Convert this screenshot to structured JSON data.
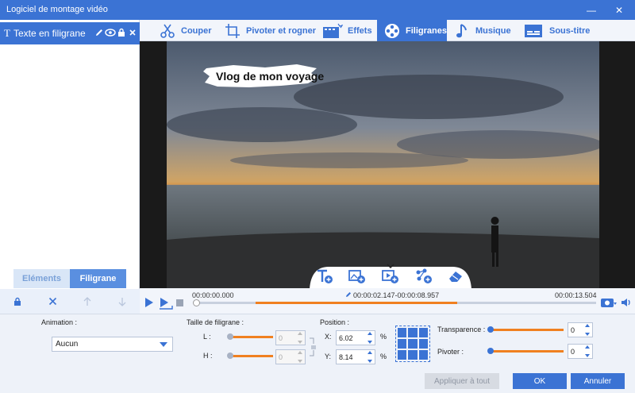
{
  "window": {
    "title": "Logiciel de montage vidéo",
    "minimize": "—",
    "close": "✕"
  },
  "sidebar": {
    "watermark_item": "Texte en filigrane",
    "tabs": {
      "elements": "Eléments",
      "filigrane": "Filigrane"
    }
  },
  "tabs": [
    {
      "label": "Couper",
      "icon": "cut-icon"
    },
    {
      "label": "Pivoter et rogner",
      "icon": "rotate-crop-icon"
    },
    {
      "label": "Effets",
      "icon": "effects-icon"
    },
    {
      "label": "Filigranes",
      "icon": "watermark-icon",
      "active": true
    },
    {
      "label": "Musique",
      "icon": "music-icon"
    },
    {
      "label": "Sous-titre",
      "icon": "subtitle-icon"
    }
  ],
  "video": {
    "watermark_text": "Vlog de mon voyage"
  },
  "timeline": {
    "start": "00:00:00.000",
    "selection": "00:00:02.147-00:00:08.957",
    "end": "00:00:13.504"
  },
  "controls": {
    "animation_label": "Animation :",
    "animation_value": "Aucun",
    "size_label": "Taille de filigrane :",
    "l_label": "L :",
    "h_label": "H :",
    "l_value": "0",
    "h_value": "0",
    "position_label": "Position :",
    "x_label": "X:",
    "y_label": "Y:",
    "x_value": "6.02",
    "y_value": "8.14",
    "percent": "%",
    "transparency_label": "Transparence :",
    "transparency_value": "0",
    "rotate_label": "Pivoter :",
    "rotate_value": "0",
    "apply_all": "Appliquer à tout",
    "ok": "OK",
    "cancel": "Annuler"
  },
  "colors": {
    "accent": "#3b73d4",
    "orange": "#f08020"
  }
}
